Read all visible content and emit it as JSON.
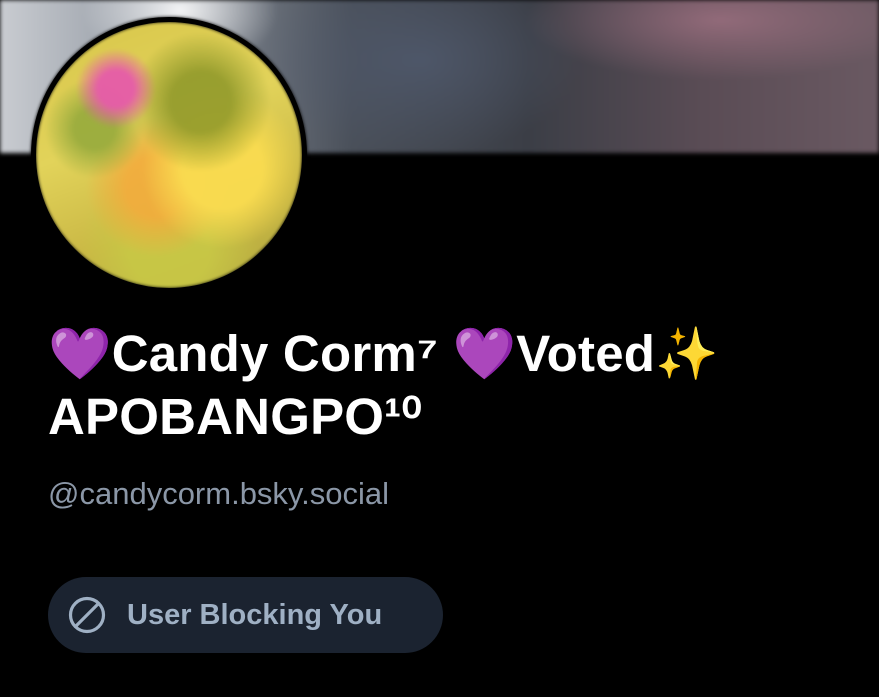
{
  "profile": {
    "display_name": "💜Candy Corm⁷ 💜Voted✨ APOBANGPO¹⁰",
    "handle": "@candycorm.bsky.social"
  },
  "block_status": {
    "label": "User Blocking You",
    "icon": "ban-icon"
  },
  "colors": {
    "background": "#000000",
    "name_text": "#ffffff",
    "handle_text": "#8b97a7",
    "pill_background": "#1b2330",
    "pill_text": "#9fb0c4"
  }
}
